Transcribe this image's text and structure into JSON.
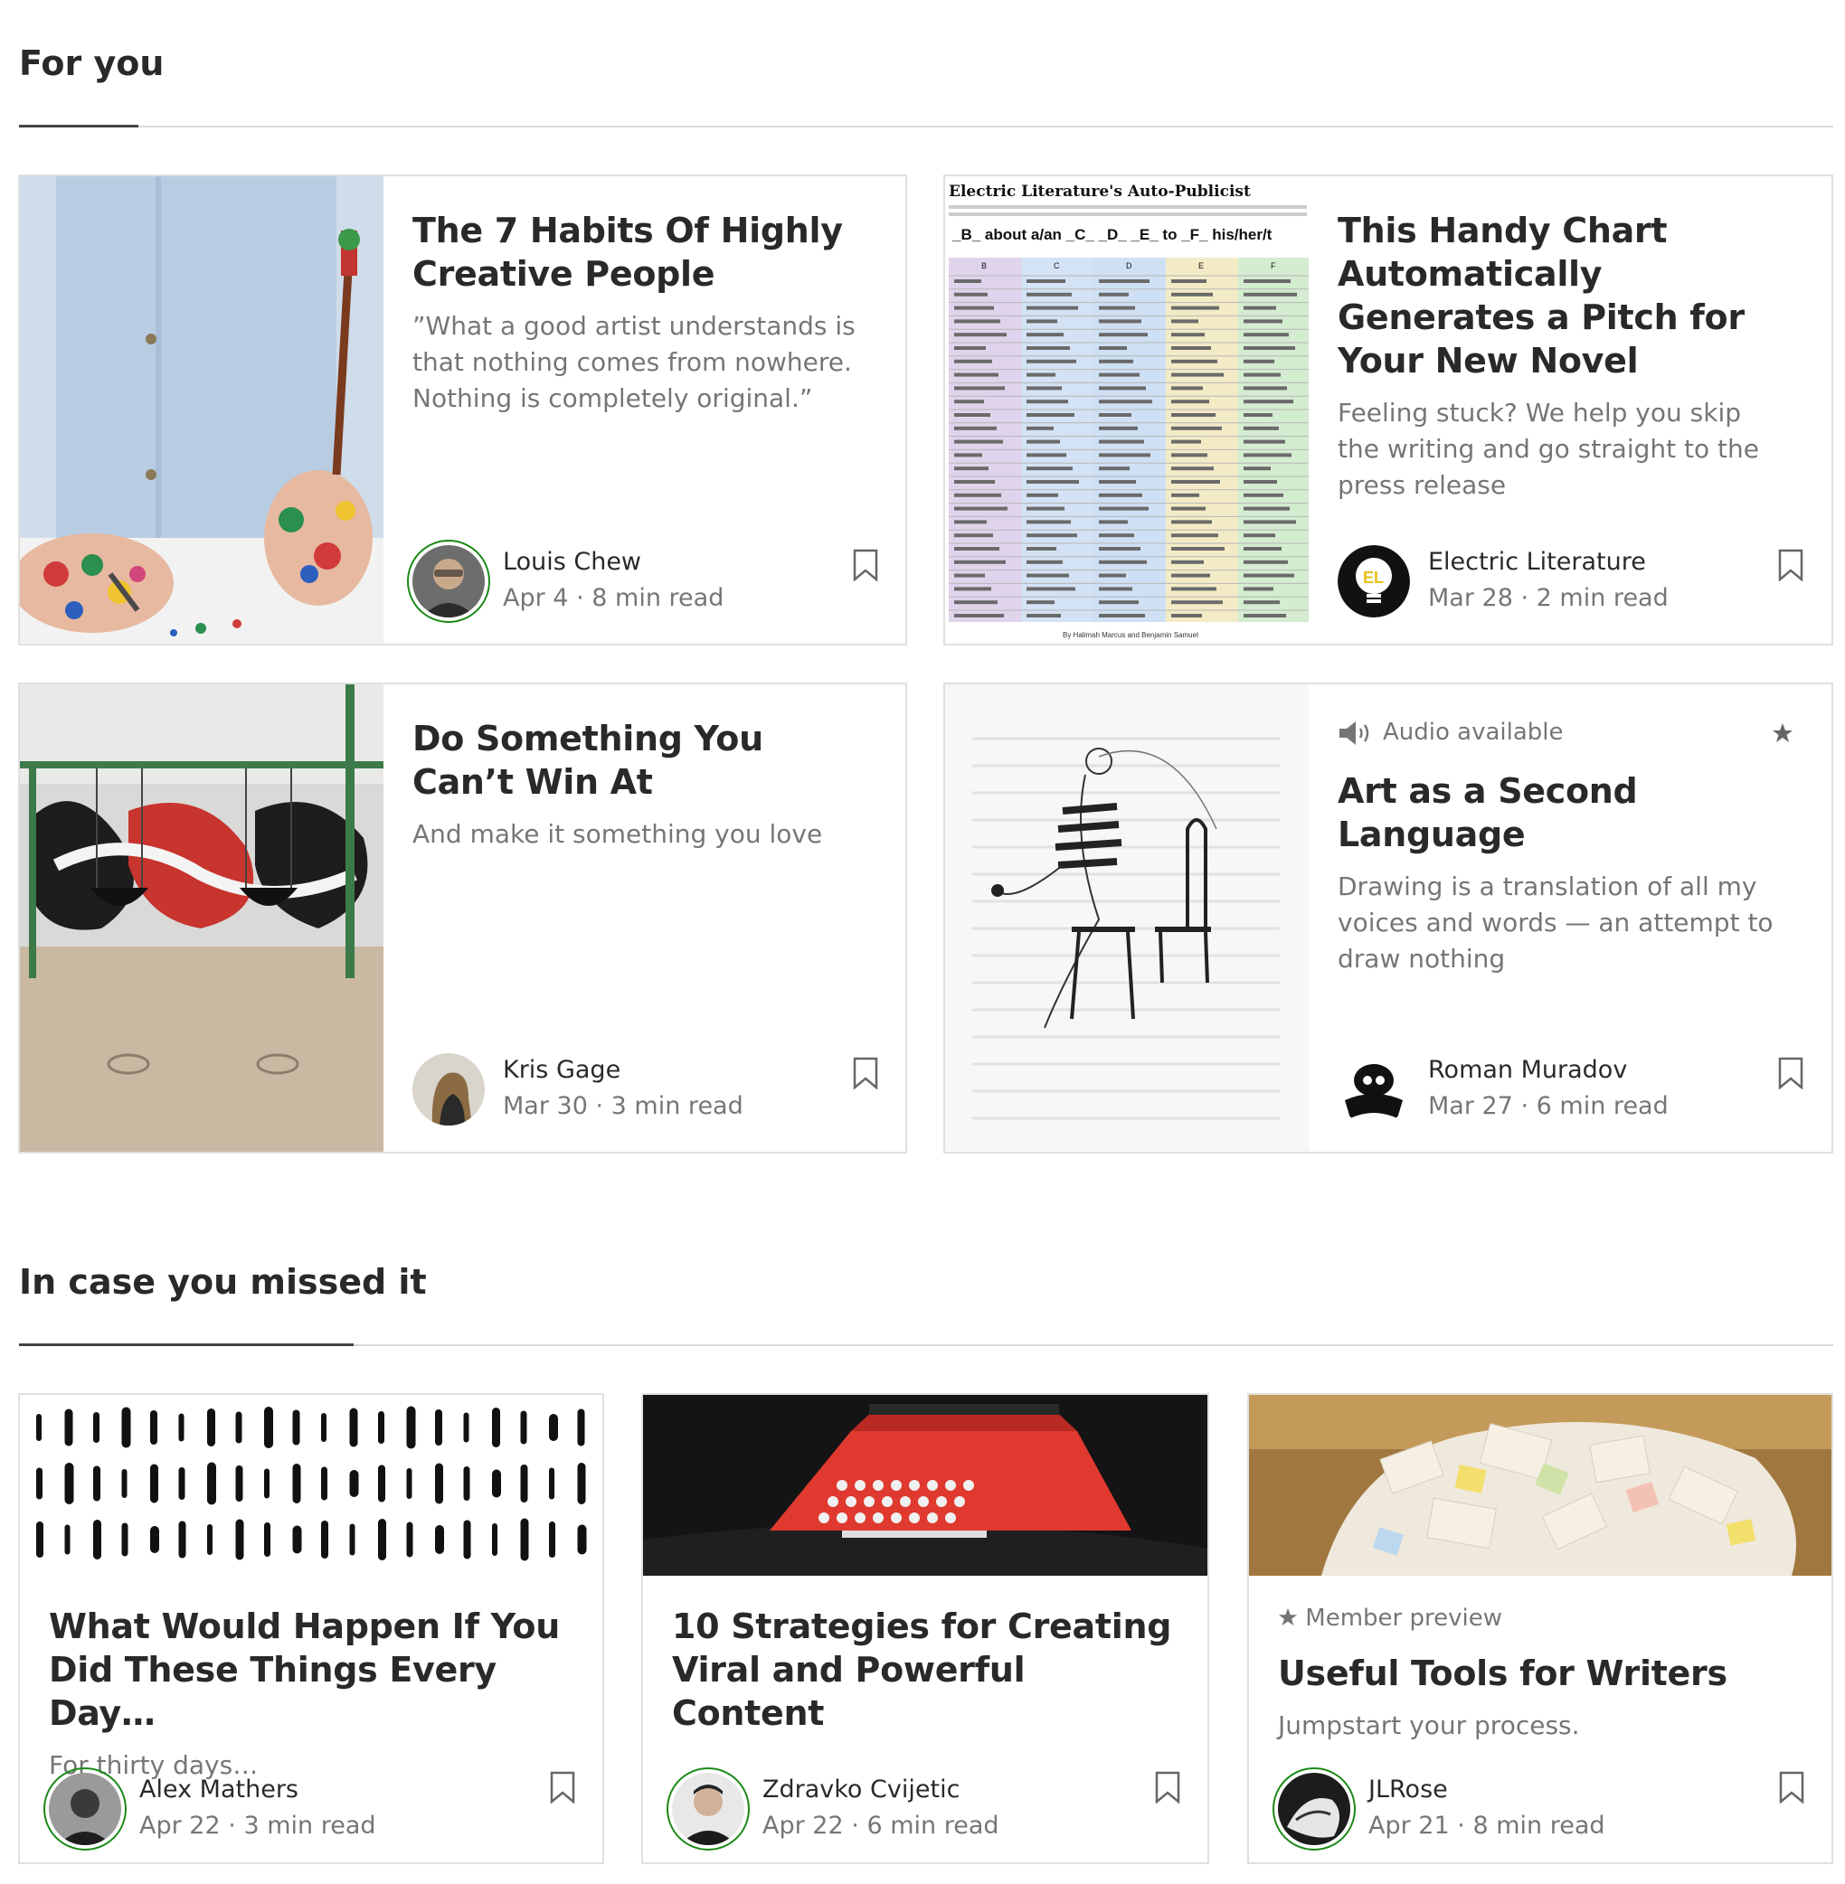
{
  "sections": {
    "for_you": {
      "title": "For you"
    },
    "missed": {
      "title": "In case you missed it"
    }
  },
  "for_you_cards": [
    {
      "title": "The 7 Habits Of Highly Creative People",
      "subtitle": "”What a good artist understands is that nothing comes from nowhere. Nothing is completely original.”",
      "author": "Louis Chew",
      "date": "Apr 4",
      "read_time": "8 min read",
      "image": "painted-hands-image"
    },
    {
      "title": "This Handy Chart Automatically Generates a Pitch for Your New Novel",
      "subtitle": "Feeling stuck? We help you skip the writing and go straight to the press release",
      "author": "Electric Literature",
      "date": "Mar 28",
      "read_time": "2 min read",
      "image": "auto-publicist-chart-image",
      "chart_caption": "Electric Literature's Auto-Publicist",
      "chart_blank": "_B_ about a/an _C_ _D_ _E_ to _F_ his/her/t",
      "chart_columns": [
        "B",
        "C",
        "D",
        "E",
        "F"
      ],
      "chart_byline": "By Halimah Marcus and Benjamin Samuel"
    },
    {
      "title": "Do Something You Can’t Win At",
      "subtitle": "And make it something you love",
      "author": "Kris Gage",
      "date": "Mar 30",
      "read_time": "3 min read",
      "image": "graffiti-swings-image"
    },
    {
      "badge": "Audio available",
      "title": "Art as a Second Language",
      "subtitle": "Drawing is a translation of all my voices and words — an attempt to draw nothing",
      "author": "Roman Muradov",
      "date": "Mar 27",
      "read_time": "6 min read",
      "image": "line-drawing-image"
    }
  ],
  "missed_cards": [
    {
      "title": "What Would Happen If You Did These Things Every Day…",
      "subtitle": "For thirty days…",
      "author": "Alex Mathers",
      "date": "Apr 22",
      "read_time": "3 min read",
      "image": "tally-marks-image"
    },
    {
      "title": "10 Strategies for Creating Viral and Powerful Content",
      "subtitle": "",
      "author": "Zdravko Cvijetic",
      "date": "Apr 22",
      "read_time": "6 min read",
      "image": "red-typewriter-image"
    },
    {
      "badge": "Member preview",
      "title": "Useful Tools for Writers",
      "subtitle": "Jumpstart your process.",
      "author": "JLRose",
      "date": "Apr 21",
      "read_time": "8 min read",
      "image": "paper-pile-image"
    }
  ],
  "separator": "·",
  "colors": {
    "accent_green": "#1a8917",
    "text_dark": "#292929",
    "text_muted": "#757575"
  }
}
